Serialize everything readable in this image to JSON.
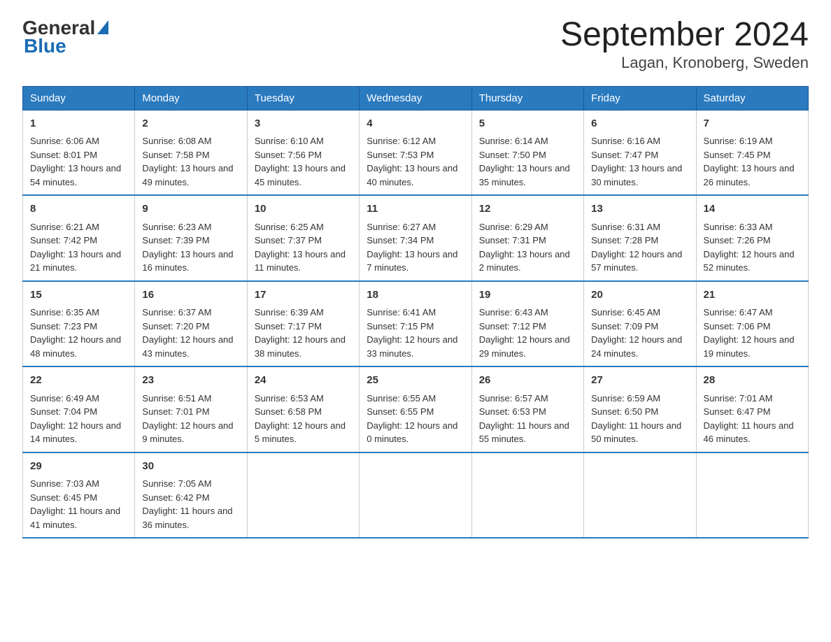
{
  "header": {
    "logo_general": "General",
    "logo_blue": "Blue",
    "title": "September 2024",
    "subtitle": "Lagan, Kronoberg, Sweden"
  },
  "days_of_week": [
    "Sunday",
    "Monday",
    "Tuesday",
    "Wednesday",
    "Thursday",
    "Friday",
    "Saturday"
  ],
  "weeks": [
    [
      {
        "day": "1",
        "sunrise": "Sunrise: 6:06 AM",
        "sunset": "Sunset: 8:01 PM",
        "daylight": "Daylight: 13 hours and 54 minutes."
      },
      {
        "day": "2",
        "sunrise": "Sunrise: 6:08 AM",
        "sunset": "Sunset: 7:58 PM",
        "daylight": "Daylight: 13 hours and 49 minutes."
      },
      {
        "day": "3",
        "sunrise": "Sunrise: 6:10 AM",
        "sunset": "Sunset: 7:56 PM",
        "daylight": "Daylight: 13 hours and 45 minutes."
      },
      {
        "day": "4",
        "sunrise": "Sunrise: 6:12 AM",
        "sunset": "Sunset: 7:53 PM",
        "daylight": "Daylight: 13 hours and 40 minutes."
      },
      {
        "day": "5",
        "sunrise": "Sunrise: 6:14 AM",
        "sunset": "Sunset: 7:50 PM",
        "daylight": "Daylight: 13 hours and 35 minutes."
      },
      {
        "day": "6",
        "sunrise": "Sunrise: 6:16 AM",
        "sunset": "Sunset: 7:47 PM",
        "daylight": "Daylight: 13 hours and 30 minutes."
      },
      {
        "day": "7",
        "sunrise": "Sunrise: 6:19 AM",
        "sunset": "Sunset: 7:45 PM",
        "daylight": "Daylight: 13 hours and 26 minutes."
      }
    ],
    [
      {
        "day": "8",
        "sunrise": "Sunrise: 6:21 AM",
        "sunset": "Sunset: 7:42 PM",
        "daylight": "Daylight: 13 hours and 21 minutes."
      },
      {
        "day": "9",
        "sunrise": "Sunrise: 6:23 AM",
        "sunset": "Sunset: 7:39 PM",
        "daylight": "Daylight: 13 hours and 16 minutes."
      },
      {
        "day": "10",
        "sunrise": "Sunrise: 6:25 AM",
        "sunset": "Sunset: 7:37 PM",
        "daylight": "Daylight: 13 hours and 11 minutes."
      },
      {
        "day": "11",
        "sunrise": "Sunrise: 6:27 AM",
        "sunset": "Sunset: 7:34 PM",
        "daylight": "Daylight: 13 hours and 7 minutes."
      },
      {
        "day": "12",
        "sunrise": "Sunrise: 6:29 AM",
        "sunset": "Sunset: 7:31 PM",
        "daylight": "Daylight: 13 hours and 2 minutes."
      },
      {
        "day": "13",
        "sunrise": "Sunrise: 6:31 AM",
        "sunset": "Sunset: 7:28 PM",
        "daylight": "Daylight: 12 hours and 57 minutes."
      },
      {
        "day": "14",
        "sunrise": "Sunrise: 6:33 AM",
        "sunset": "Sunset: 7:26 PM",
        "daylight": "Daylight: 12 hours and 52 minutes."
      }
    ],
    [
      {
        "day": "15",
        "sunrise": "Sunrise: 6:35 AM",
        "sunset": "Sunset: 7:23 PM",
        "daylight": "Daylight: 12 hours and 48 minutes."
      },
      {
        "day": "16",
        "sunrise": "Sunrise: 6:37 AM",
        "sunset": "Sunset: 7:20 PM",
        "daylight": "Daylight: 12 hours and 43 minutes."
      },
      {
        "day": "17",
        "sunrise": "Sunrise: 6:39 AM",
        "sunset": "Sunset: 7:17 PM",
        "daylight": "Daylight: 12 hours and 38 minutes."
      },
      {
        "day": "18",
        "sunrise": "Sunrise: 6:41 AM",
        "sunset": "Sunset: 7:15 PM",
        "daylight": "Daylight: 12 hours and 33 minutes."
      },
      {
        "day": "19",
        "sunrise": "Sunrise: 6:43 AM",
        "sunset": "Sunset: 7:12 PM",
        "daylight": "Daylight: 12 hours and 29 minutes."
      },
      {
        "day": "20",
        "sunrise": "Sunrise: 6:45 AM",
        "sunset": "Sunset: 7:09 PM",
        "daylight": "Daylight: 12 hours and 24 minutes."
      },
      {
        "day": "21",
        "sunrise": "Sunrise: 6:47 AM",
        "sunset": "Sunset: 7:06 PM",
        "daylight": "Daylight: 12 hours and 19 minutes."
      }
    ],
    [
      {
        "day": "22",
        "sunrise": "Sunrise: 6:49 AM",
        "sunset": "Sunset: 7:04 PM",
        "daylight": "Daylight: 12 hours and 14 minutes."
      },
      {
        "day": "23",
        "sunrise": "Sunrise: 6:51 AM",
        "sunset": "Sunset: 7:01 PM",
        "daylight": "Daylight: 12 hours and 9 minutes."
      },
      {
        "day": "24",
        "sunrise": "Sunrise: 6:53 AM",
        "sunset": "Sunset: 6:58 PM",
        "daylight": "Daylight: 12 hours and 5 minutes."
      },
      {
        "day": "25",
        "sunrise": "Sunrise: 6:55 AM",
        "sunset": "Sunset: 6:55 PM",
        "daylight": "Daylight: 12 hours and 0 minutes."
      },
      {
        "day": "26",
        "sunrise": "Sunrise: 6:57 AM",
        "sunset": "Sunset: 6:53 PM",
        "daylight": "Daylight: 11 hours and 55 minutes."
      },
      {
        "day": "27",
        "sunrise": "Sunrise: 6:59 AM",
        "sunset": "Sunset: 6:50 PM",
        "daylight": "Daylight: 11 hours and 50 minutes."
      },
      {
        "day": "28",
        "sunrise": "Sunrise: 7:01 AM",
        "sunset": "Sunset: 6:47 PM",
        "daylight": "Daylight: 11 hours and 46 minutes."
      }
    ],
    [
      {
        "day": "29",
        "sunrise": "Sunrise: 7:03 AM",
        "sunset": "Sunset: 6:45 PM",
        "daylight": "Daylight: 11 hours and 41 minutes."
      },
      {
        "day": "30",
        "sunrise": "Sunrise: 7:05 AM",
        "sunset": "Sunset: 6:42 PM",
        "daylight": "Daylight: 11 hours and 36 minutes."
      },
      null,
      null,
      null,
      null,
      null
    ]
  ]
}
